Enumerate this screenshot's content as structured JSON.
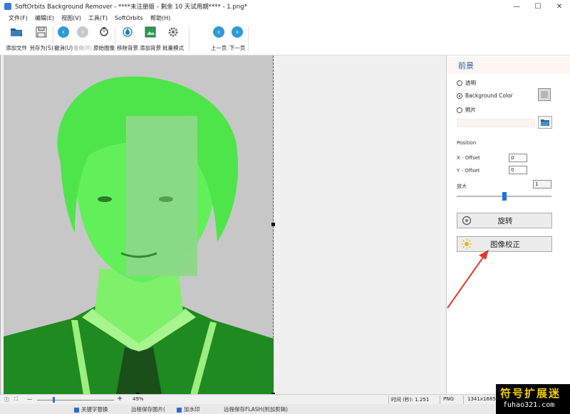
{
  "window": {
    "title": "SoftOrbits Background Remover - ****未注册版 - 剩余 10 天试用期**** - 1.png*",
    "controls": {
      "minimize": "—",
      "maximize": "☐",
      "close": "✕"
    }
  },
  "menu": {
    "items": [
      "文件(F)",
      "编辑(E)",
      "视图(V)",
      "工具(T)",
      "SoftOrbits",
      "帮助(H)"
    ]
  },
  "toolbar": {
    "add_file": "添加文件",
    "save_as": "另存为(S)",
    "undo": "撤消(U)",
    "redo": "重做(R)",
    "original": "原始图像",
    "remove_bg": "移除背景",
    "add_bg": "添加背景",
    "batch": "批量模式",
    "prev": "上一页",
    "next": "下一页"
  },
  "panel": {
    "header": "前景",
    "radio_transparent": "透明",
    "radio_bg_color": "Background Color",
    "radio_photo": "照片",
    "position_label": "Position",
    "x_label": "X - Offset",
    "x_value": "0",
    "y_label": "Y - Offset",
    "y_value": "0",
    "zoom_label": "放大",
    "zoom_value": "1",
    "zoom_slider_fraction": 0.5,
    "rotate_btn": "旋转",
    "correct_btn": "图像校正",
    "selected_radio": "bg_color",
    "accent": "#2a5fa8"
  },
  "status": {
    "zoom_minus": "—",
    "zoom_plus": "+",
    "zoom_percent": "49%",
    "time": "时间 (秒): 1.251",
    "format": "PNG",
    "size": "1341x1685"
  },
  "under_window": {
    "item1": "关键字替换",
    "item2": "远程保存图片(",
    "item3": "加水印",
    "item4": "远程保存FLASH(附加剪辑)"
  },
  "watermark": {
    "line1": "符号扩展迷",
    "line2": "fuhao321.com"
  },
  "colors": {
    "foreground_overlay": "#5df25a",
    "canvas_bg": "#c7c7c7",
    "arrow": "#e23a2a"
  }
}
